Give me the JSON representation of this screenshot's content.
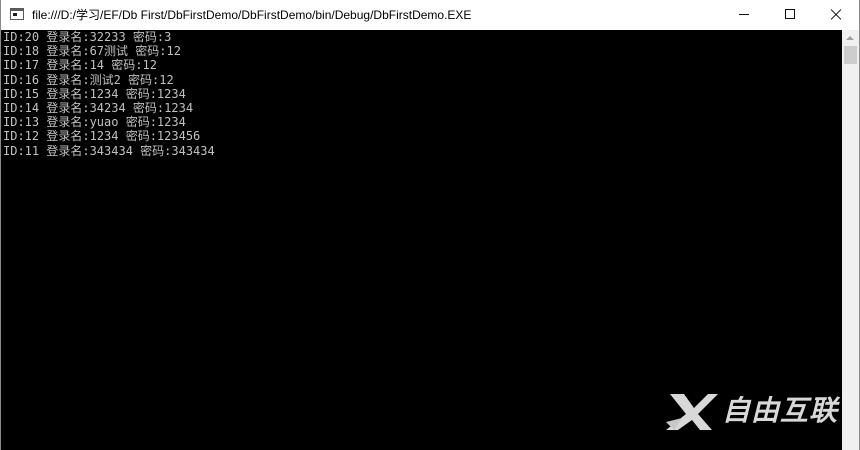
{
  "window": {
    "title": "file:///D:/学习/EF/Db First/DbFirstDemo/DbFirstDemo/bin/Debug/DbFirstDemo.EXE"
  },
  "console": {
    "lines": [
      "ID:20 登录名:32233 密码:3",
      "ID:18 登录名:67测试 密码:12",
      "ID:17 登录名:14 密码:12",
      "ID:16 登录名:测试2 密码:12",
      "ID:15 登录名:1234 密码:1234",
      "ID:14 登录名:34234 密码:1234",
      "ID:13 登录名:yuao 密码:1234",
      "ID:12 登录名:1234 密码:123456",
      "ID:11 登录名:343434 密码:343434"
    ]
  },
  "watermark": {
    "text": "自由互联"
  },
  "icons": {
    "app": "console-app-icon",
    "minimize": "minimize-icon",
    "maximize": "maximize-icon",
    "close": "close-icon",
    "watermark": "watermark-logo-icon"
  },
  "colors": {
    "console_background": "#000000",
    "console_text": "#c0c0c0",
    "titlebar_background": "#ffffff",
    "scrollbar_track": "#f0f0f0",
    "scrollbar_thumb": "#cdcdcd"
  }
}
